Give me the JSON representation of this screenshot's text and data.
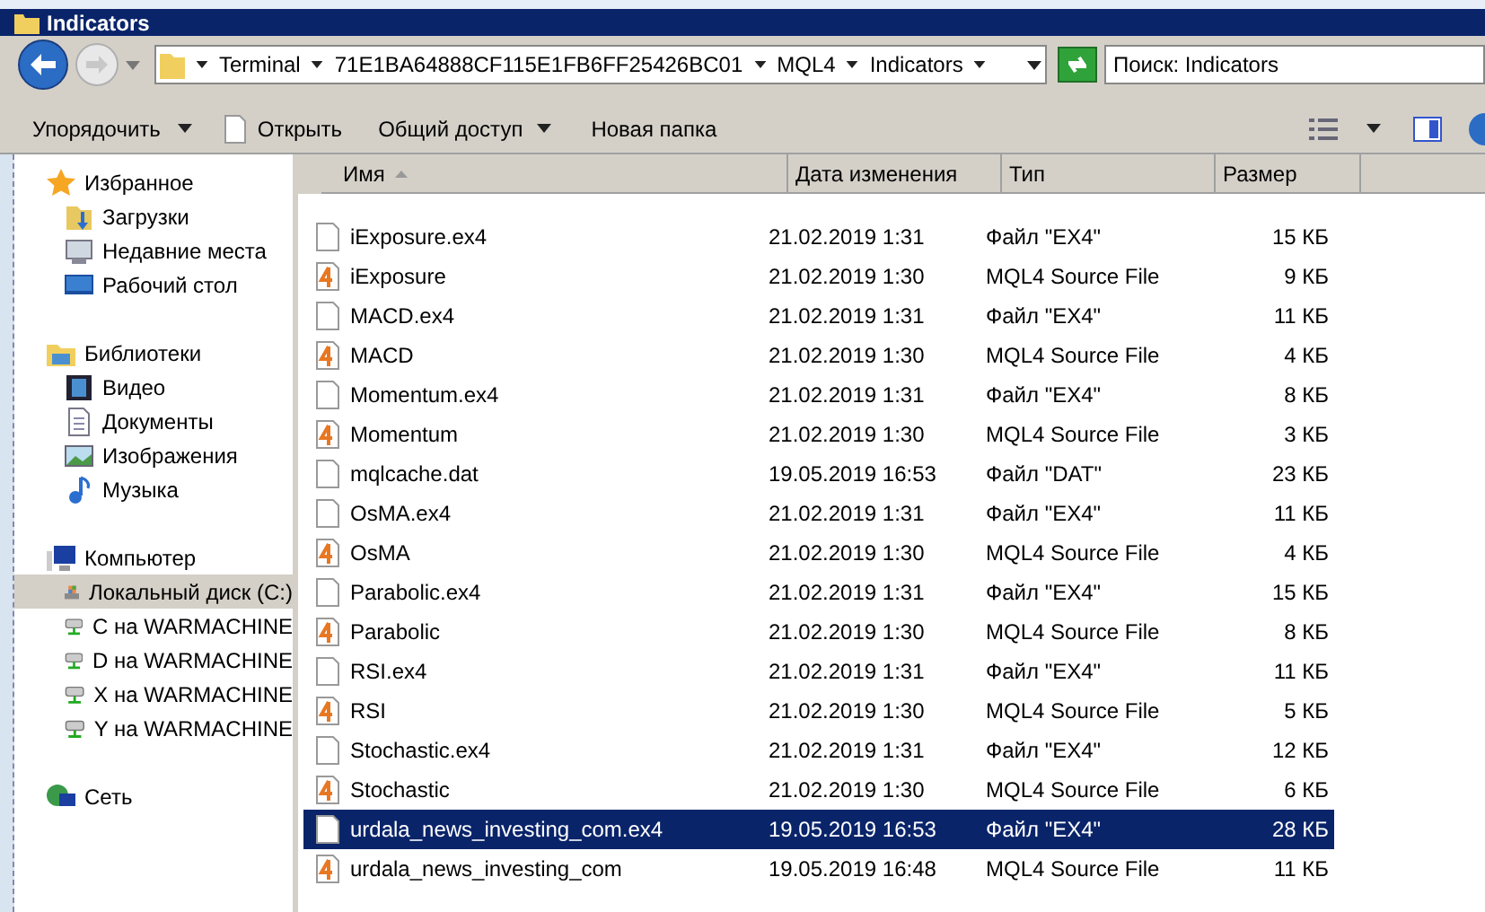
{
  "window": {
    "title": "Indicators"
  },
  "address": {
    "crumbs": [
      "Terminal",
      "71E1BA64888CF115E1FB6FF25426BC01",
      "MQL4",
      "Indicators"
    ]
  },
  "search": {
    "placeholder": "Поиск: Indicators"
  },
  "toolbar": {
    "organize": "Упорядочить",
    "open": "Открыть",
    "share": "Общий доступ",
    "new_folder": "Новая папка"
  },
  "sidebar": {
    "groups": [
      {
        "label": "Избранное",
        "children": [
          {
            "label": "Загрузки",
            "selected": false
          },
          {
            "label": "Недавние места",
            "selected": false
          },
          {
            "label": "Рабочий стол",
            "selected": false
          }
        ]
      },
      {
        "label": "Библиотеки",
        "children": [
          {
            "label": "Видео",
            "selected": false
          },
          {
            "label": "Документы",
            "selected": false
          },
          {
            "label": "Изображения",
            "selected": false
          },
          {
            "label": "Музыка",
            "selected": false
          }
        ]
      },
      {
        "label": "Компьютер",
        "children": [
          {
            "label": "Локальный диск (C:)",
            "selected": true
          },
          {
            "label": "C на WARMACHINE",
            "selected": false
          },
          {
            "label": "D на WARMACHINE",
            "selected": false
          },
          {
            "label": "X на WARMACHINE",
            "selected": false
          },
          {
            "label": "Y на WARMACHINE",
            "selected": false
          }
        ]
      },
      {
        "label": "Сеть"
      }
    ]
  },
  "table": {
    "columns": [
      "Имя",
      "Дата изменения",
      "Тип",
      "Размер"
    ],
    "rows": [
      {
        "kind": "ex4",
        "name": "iExposure.ex4",
        "date": "21.02.2019 1:31",
        "type": "Файл \"EX4\"",
        "size": "15 КБ",
        "selected": false
      },
      {
        "kind": "mq4",
        "name": "iExposure",
        "date": "21.02.2019 1:30",
        "type": "MQL4 Source File",
        "size": "9 КБ",
        "selected": false
      },
      {
        "kind": "ex4",
        "name": "MACD.ex4",
        "date": "21.02.2019 1:31",
        "type": "Файл \"EX4\"",
        "size": "11 КБ",
        "selected": false
      },
      {
        "kind": "mq4",
        "name": "MACD",
        "date": "21.02.2019 1:30",
        "type": "MQL4 Source File",
        "size": "4 КБ",
        "selected": false
      },
      {
        "kind": "ex4",
        "name": "Momentum.ex4",
        "date": "21.02.2019 1:31",
        "type": "Файл \"EX4\"",
        "size": "8 КБ",
        "selected": false
      },
      {
        "kind": "mq4",
        "name": "Momentum",
        "date": "21.02.2019 1:30",
        "type": "MQL4 Source File",
        "size": "3 КБ",
        "selected": false
      },
      {
        "kind": "ex4",
        "name": "mqlcache.dat",
        "date": "19.05.2019 16:53",
        "type": "Файл \"DAT\"",
        "size": "23 КБ",
        "selected": false
      },
      {
        "kind": "ex4",
        "name": "OsMA.ex4",
        "date": "21.02.2019 1:31",
        "type": "Файл \"EX4\"",
        "size": "11 КБ",
        "selected": false
      },
      {
        "kind": "mq4",
        "name": "OsMA",
        "date": "21.02.2019 1:30",
        "type": "MQL4 Source File",
        "size": "4 КБ",
        "selected": false
      },
      {
        "kind": "ex4",
        "name": "Parabolic.ex4",
        "date": "21.02.2019 1:31",
        "type": "Файл \"EX4\"",
        "size": "15 КБ",
        "selected": false
      },
      {
        "kind": "mq4",
        "name": "Parabolic",
        "date": "21.02.2019 1:30",
        "type": "MQL4 Source File",
        "size": "8 КБ",
        "selected": false
      },
      {
        "kind": "ex4",
        "name": "RSI.ex4",
        "date": "21.02.2019 1:31",
        "type": "Файл \"EX4\"",
        "size": "11 КБ",
        "selected": false
      },
      {
        "kind": "mq4",
        "name": "RSI",
        "date": "21.02.2019 1:30",
        "type": "MQL4 Source File",
        "size": "5 КБ",
        "selected": false
      },
      {
        "kind": "ex4",
        "name": "Stochastic.ex4",
        "date": "21.02.2019 1:31",
        "type": "Файл \"EX4\"",
        "size": "12 КБ",
        "selected": false
      },
      {
        "kind": "mq4",
        "name": "Stochastic",
        "date": "21.02.2019 1:30",
        "type": "MQL4 Source File",
        "size": "6 КБ",
        "selected": false
      },
      {
        "kind": "ex4",
        "name": "urdala_news_investing_com.ex4",
        "date": "19.05.2019 16:53",
        "type": "Файл \"EX4\"",
        "size": "28 КБ",
        "selected": true
      },
      {
        "kind": "mq4",
        "name": "urdala_news_investing_com",
        "date": "19.05.2019 16:48",
        "type": "MQL4 Source File",
        "size": "11 КБ",
        "selected": false
      }
    ]
  }
}
